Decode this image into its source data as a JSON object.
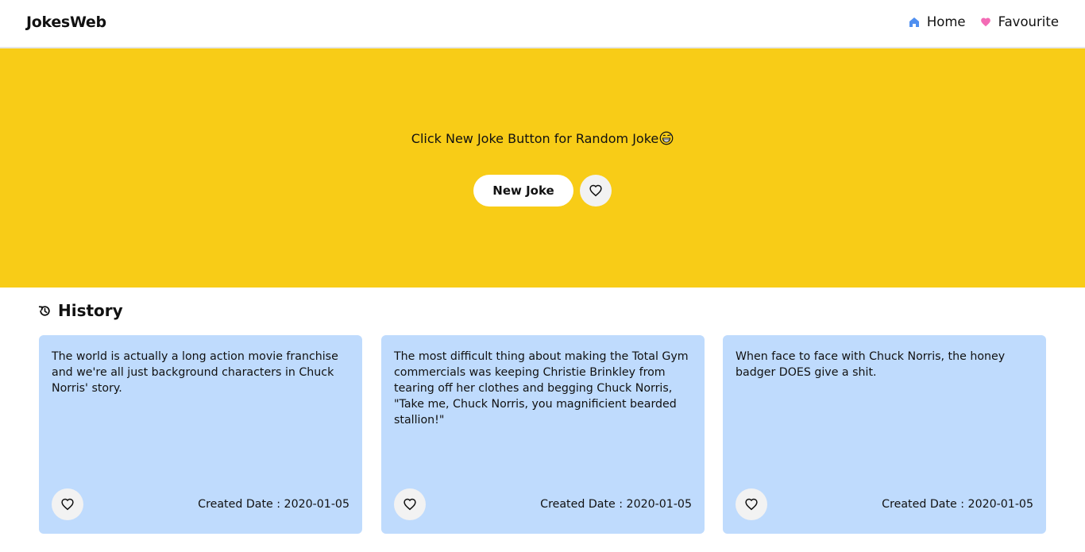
{
  "header": {
    "brand": "JokesWeb",
    "nav": [
      {
        "label": "Home",
        "icon": "home-icon"
      },
      {
        "label": "Favourite",
        "icon": "heart-filled-icon"
      }
    ]
  },
  "hero": {
    "prompt": "Click New Joke Button for Random Joke",
    "emoji": "grinning-sweat-emoji",
    "new_joke_label": "New Joke",
    "favourite_icon": "heart-outline-icon"
  },
  "history": {
    "title": "History",
    "icon": "history-icon",
    "cards": [
      {
        "text": "The world is actually a long action movie franchise and we're all just background characters in Chuck Norris' story.",
        "date": "Created Date : 2020-01-05"
      },
      {
        "text": "The most difficult thing about making the Total Gym commercials was keeping Christie Brinkley from tearing off her clothes and begging Chuck Norris, \"Take me, Chuck Norris, you magnificient bearded stallion!\"",
        "date": "Created Date : 2020-01-05"
      },
      {
        "text": "When face to face with Chuck Norris, the honey badger DOES give a shit.",
        "date": "Created Date : 2020-01-05"
      }
    ]
  },
  "colors": {
    "hero_background": "#f8cc17",
    "card_background": "#bfdbfd",
    "home_icon": "#4f8ff0",
    "favourite_icon": "#f36bb5"
  }
}
